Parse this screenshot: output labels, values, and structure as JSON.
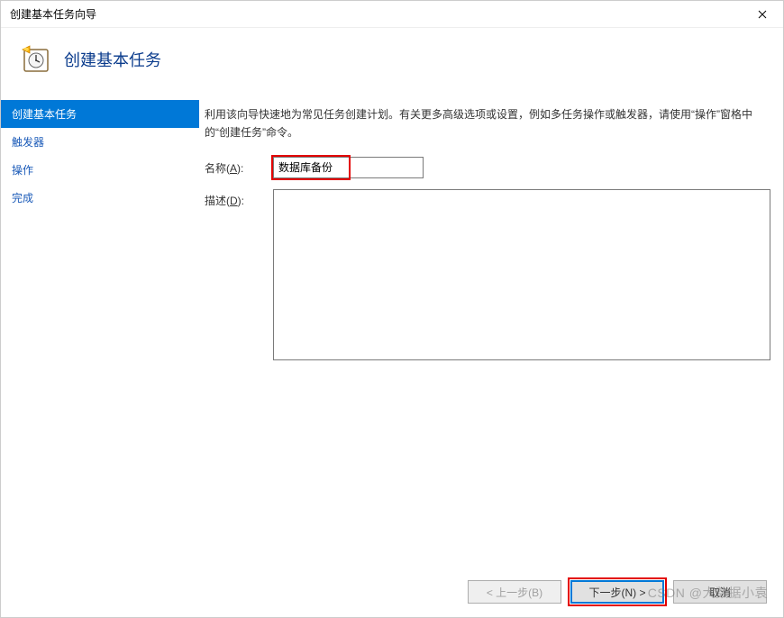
{
  "window": {
    "title": "创建基本任务向导"
  },
  "header": {
    "title": "创建基本任务"
  },
  "sidebar": {
    "items": [
      {
        "label": "创建基本任务",
        "active": true
      },
      {
        "label": "触发器",
        "active": false
      },
      {
        "label": "操作",
        "active": false
      },
      {
        "label": "完成",
        "active": false
      }
    ]
  },
  "main": {
    "intro": "利用该向导快速地为常见任务创建计划。有关更多高级选项或设置，例如多任务操作或触发器，请使用“操作”窗格中的“创建任务”命令。",
    "name_label_prefix": "名称(",
    "name_label_key": "A",
    "name_label_suffix": "):",
    "name_value": "数据库备份",
    "desc_label_prefix": "描述(",
    "desc_label_key": "D",
    "desc_label_suffix": "):",
    "desc_value": ""
  },
  "footer": {
    "back": "< 上一步(B)",
    "next": "下一步(N) >",
    "cancel": "取消"
  },
  "watermark": "CSDN @大数据小袁"
}
